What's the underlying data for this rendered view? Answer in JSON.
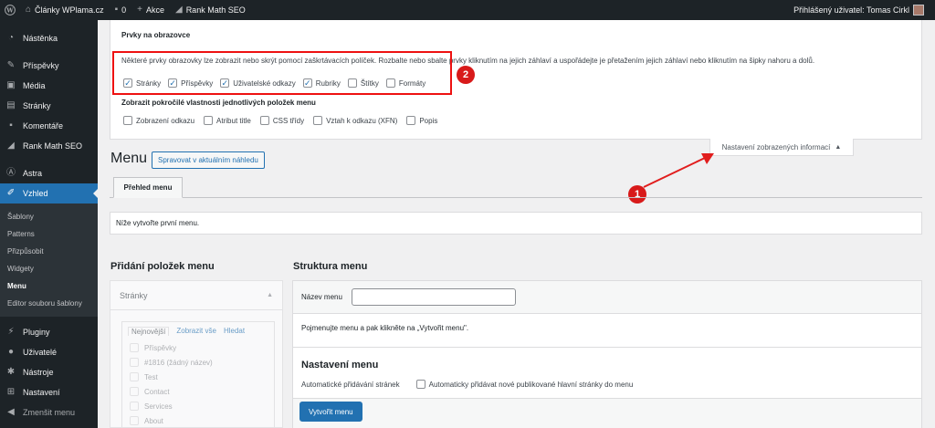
{
  "adminbar": {
    "site_name": "Články WPlama.cz",
    "comments_count": "0",
    "new_label": "Akce",
    "seo_label": "Rank Math SEO",
    "user_label": "Přihlášený uživatel: Tomas Cirkl"
  },
  "sidebar": {
    "items": [
      {
        "label": "Nástěnka",
        "icon": "dashboard-icon"
      },
      {
        "label": "Příspěvky",
        "icon": "pin-icon"
      },
      {
        "label": "Média",
        "icon": "media-icon"
      },
      {
        "label": "Stránky",
        "icon": "page-icon"
      },
      {
        "label": "Komentáře",
        "icon": "comment-icon"
      },
      {
        "label": "Rank Math SEO",
        "icon": "chart-icon"
      },
      {
        "label": "Astra",
        "icon": "astra-icon"
      },
      {
        "label": "Vzhled",
        "icon": "brush-icon"
      }
    ],
    "submenu": [
      "Šablony",
      "Patterns",
      "Přizpůsobit",
      "Widgety",
      "Menu",
      "Editor souboru šablony"
    ],
    "items_after": [
      {
        "label": "Pluginy",
        "icon": "plugin-icon"
      },
      {
        "label": "Uživatelé",
        "icon": "user-icon"
      },
      {
        "label": "Nástroje",
        "icon": "wrench-icon"
      },
      {
        "label": "Nastavení",
        "icon": "settings-icon"
      },
      {
        "label": "Zmenšit menu",
        "icon": "collapse-icon"
      }
    ]
  },
  "screen_options": {
    "title": "Prvky na obrazovce",
    "description": "Některé prvky obrazovky lze zobrazit nebo skrýt pomocí zaškrtávacích políček. Rozbalte nebo sbalte prvky kliknutím na jejich záhlaví a uspořádejte je přetažením jejich záhlaví nebo kliknutím na šipky nahoru a dolů.",
    "boxes": [
      {
        "label": "Stránky",
        "checked": true
      },
      {
        "label": "Příspěvky",
        "checked": true
      },
      {
        "label": "Uživatelské odkazy",
        "checked": true
      },
      {
        "label": "Rubriky",
        "checked": true
      },
      {
        "label": "Štítky",
        "checked": false
      },
      {
        "label": "Formáty",
        "checked": false
      }
    ],
    "advanced_title": "Zobrazit pokročilé vlastnosti jednotlivých položek menu",
    "advanced": [
      "Zobrazení odkazu",
      "Atribut title",
      "CSS třídy",
      "Vztah k odkazu (XFN)",
      "Popis"
    ],
    "toggle_label": "Nastavení zobrazených informací"
  },
  "annotations": {
    "badge1": "1",
    "badge2": "2",
    "accent": "#e11d1d"
  },
  "page": {
    "title": "Menu",
    "live_preview_button": "Spravovat v aktuálním náhledu",
    "tab_overview": "Přehled menu",
    "notice": "Níže vytvořte první menu."
  },
  "add_items": {
    "heading": "Přidání položek menu",
    "section": "Stránky",
    "tabs": [
      "Nejnovější",
      "Zobrazit vše",
      "Hledat"
    ],
    "pages": [
      "Příspěvky",
      "#1816 (žádný název)",
      "Test",
      "Contact",
      "Services",
      "About"
    ]
  },
  "structure": {
    "heading": "Struktura menu",
    "name_label": "Název menu",
    "name_value": "",
    "instructions": "Pojmenujte menu a pak klikněte na „Vytvořit menu\".",
    "settings_heading": "Nastavení menu",
    "auto_add_label": "Automatické přidávání stránek",
    "auto_add_option": "Automaticky přidávat nové publikované hlavní stránky do menu",
    "create_button": "Vytvořit menu"
  }
}
